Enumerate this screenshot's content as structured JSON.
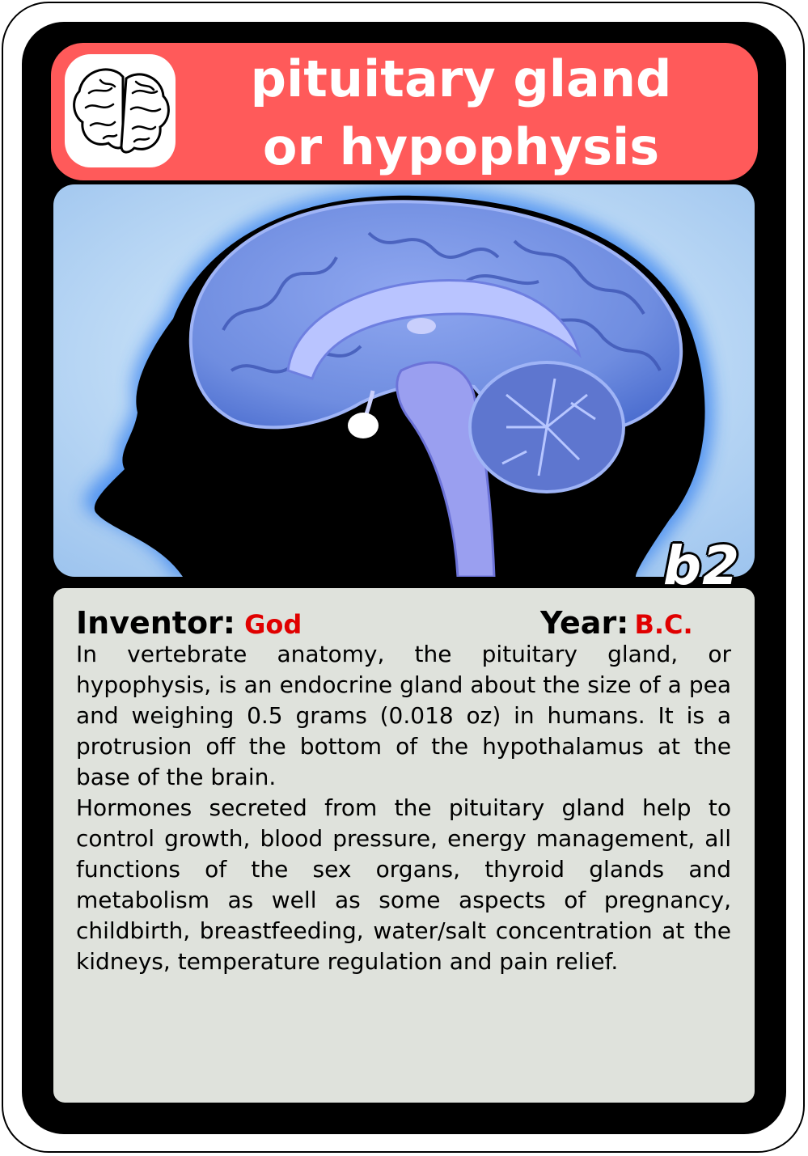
{
  "card": {
    "title_line1": "pituitary gland",
    "title_line2": "or hypophysis",
    "code": "b2",
    "logo_icon": "brain-icon",
    "inventor_label": "Inventor:",
    "inventor_value": "God",
    "year_label": "Year:",
    "year_value": "B.C.",
    "description_p1": "In vertebrate anatomy, the pituitary gland, or hypophysis, is an endocrine gland about the size of a pea and weighing 0.5 grams (0.018 oz) in humans. It is a protrusion off the bottom of the hypothalamus at the base of the brain.",
    "description_p2": "Hormones secreted from the pituitary gland help to control growth, blood pressure, energy management, all functions of the sex organs, thyroid glands and metabolism as well as some aspects of pregnancy, childbirth, breastfeeding, water/salt concentration at the kidneys, temperature regulation and pain relief."
  },
  "colors": {
    "title_bar": "#ff5a5a",
    "text_panel": "#dfe2dc",
    "value_red": "#e00000",
    "brain_blue": "#7b8ee8"
  }
}
